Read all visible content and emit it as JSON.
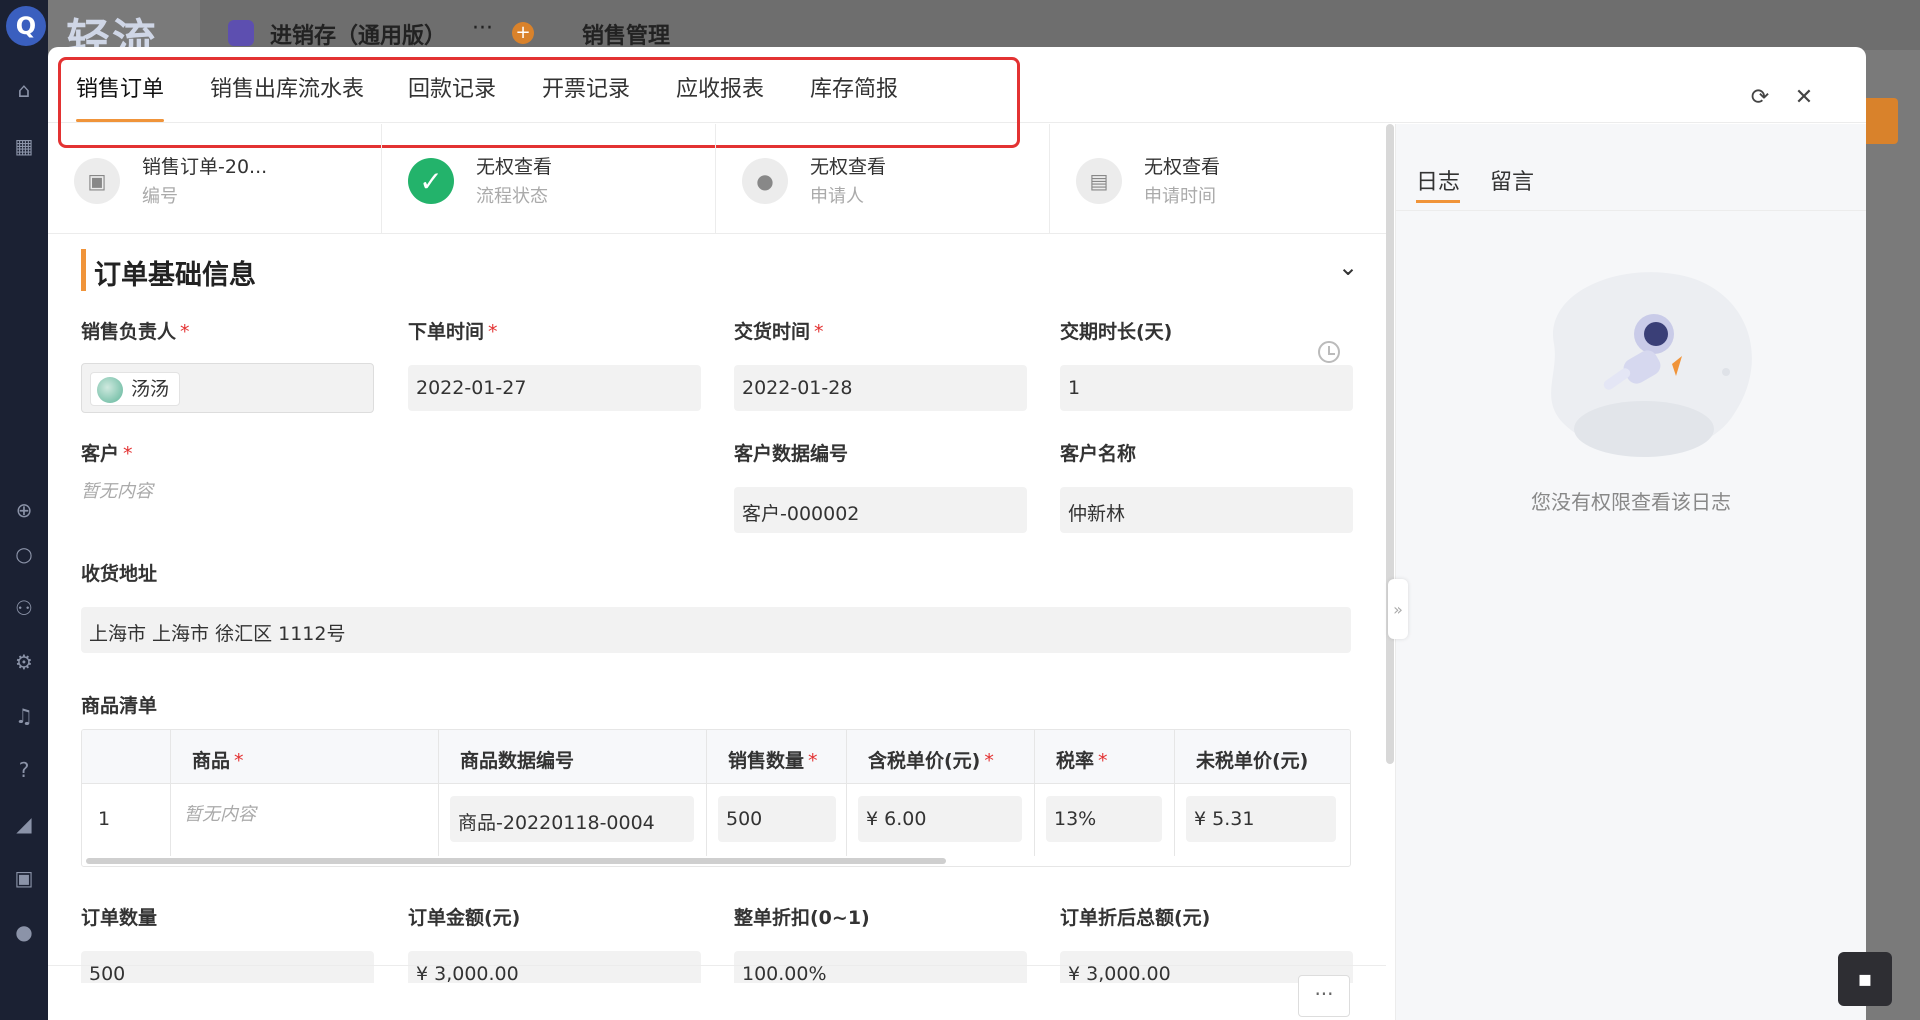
{
  "background": {
    "brand": "轻流",
    "logo_letter": "Q",
    "app_name": "进销存（通用版）",
    "menu_title": "销售管理"
  },
  "tabs": [
    {
      "label": "销售订单",
      "active": true
    },
    {
      "label": "销售出库流水表"
    },
    {
      "label": "回款记录"
    },
    {
      "label": "开票记录"
    },
    {
      "label": "应收报表"
    },
    {
      "label": "库存简报"
    }
  ],
  "header_icons": {
    "refresh": "refresh-icon",
    "close": "close-icon"
  },
  "info": [
    {
      "value": "销售订单-20...",
      "label": "编号",
      "icon": "doc-icon"
    },
    {
      "value": "无权查看",
      "label": "流程状态",
      "icon": "check-icon"
    },
    {
      "value": "无权查看",
      "label": "申请人",
      "icon": "person-icon"
    },
    {
      "value": "无权查看",
      "label": "申请时间",
      "icon": "calendar-icon"
    }
  ],
  "section": {
    "title": "订单基础信息"
  },
  "fields": {
    "owner_label": "销售负责人",
    "owner_value": "汤汤",
    "order_time_label": "下单时间",
    "order_time_value": "2022-01-27",
    "delivery_time_label": "交货时间",
    "delivery_time_value": "2022-01-28",
    "lead_days_label": "交期时长(天)",
    "lead_days_value": "1",
    "customer_label": "客户",
    "customer_empty": "暂无内容",
    "customer_code_label": "客户数据编号",
    "customer_code_value": "客户-000002",
    "customer_name_label": "客户名称",
    "customer_name_value": "仲新林",
    "address_label": "收货地址",
    "address_value": "上海市 上海市 徐汇区 1112号",
    "goods_label": "商品清单",
    "order_qty_label": "订单数量",
    "order_qty_value": "500",
    "order_amount_label": "订单金额(元)",
    "order_amount_value": "¥ 3,000.00",
    "discount_label": "整单折扣(0~1)",
    "discount_value": "100.00%",
    "discount_total_label": "订单折后总额(元)",
    "discount_total_value": "¥ 3,000.00"
  },
  "table": {
    "headers": [
      "商品",
      "商品数据编号",
      "销售数量",
      "含税单价(元)",
      "税率",
      "未税单价(元)"
    ],
    "row": {
      "index": "1",
      "product_empty": "暂无内容",
      "product_code": "商品-20220118-0004",
      "qty": "500",
      "price_tax": "¥ 6.00",
      "tax_rate": "13%",
      "price_notax": "¥ 5.31"
    }
  },
  "more_button": "···",
  "side": {
    "tabs": [
      "日志",
      "留言"
    ],
    "empty_message": "您没有权限查看该日志"
  }
}
